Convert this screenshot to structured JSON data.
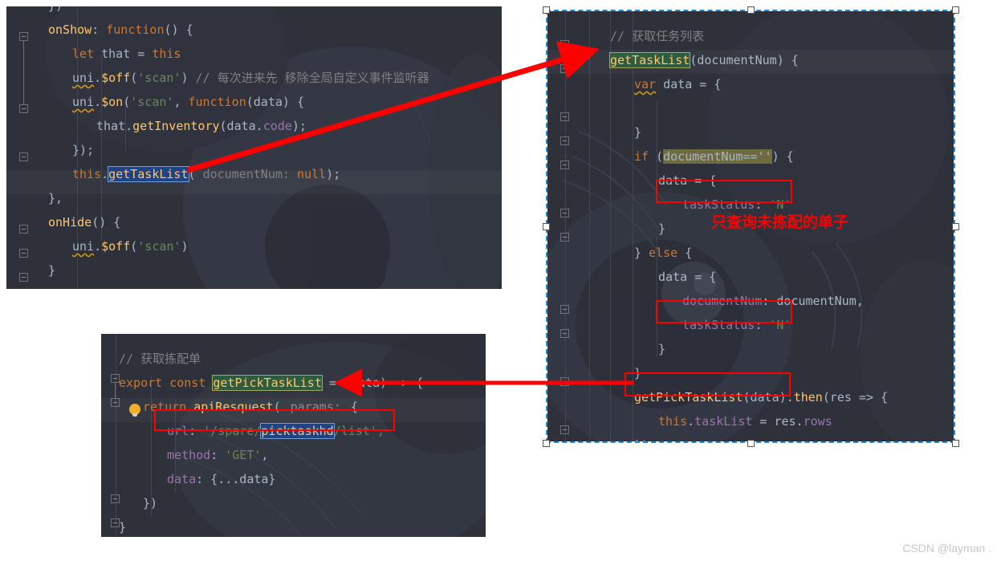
{
  "watermark": "CSDN @layman .",
  "annotation": {
    "note_cn": "只查询未拣配的单子"
  },
  "panel_left_top": {
    "name": "onShow / onHide page lifecycle code",
    "lines": [
      {
        "indent": 0,
        "tokens": [
          {
            "t": "})",
            "c": "punc"
          }
        ]
      },
      {
        "indent": 0,
        "tokens": [
          {
            "t": "onShow",
            "c": "fn"
          },
          {
            "t": ": ",
            "c": "punc"
          },
          {
            "t": "function",
            "c": "kw"
          },
          {
            "t": "() {",
            "c": "punc"
          }
        ]
      },
      {
        "indent": 1,
        "tokens": [
          {
            "t": "let",
            "c": "kw"
          },
          {
            "t": " that = ",
            "c": "txt"
          },
          {
            "t": "this",
            "c": "kw"
          }
        ]
      },
      {
        "indent": 1,
        "tokens": [
          {
            "t": "uni",
            "c": "squiggle"
          },
          {
            "t": ".",
            "c": "punc"
          },
          {
            "t": "$off",
            "c": "fn"
          },
          {
            "t": "(",
            "c": "punc"
          },
          {
            "t": "'scan'",
            "c": "str"
          },
          {
            "t": ") ",
            "c": "punc"
          },
          {
            "t": "// 每次进来先 移除全局自定义事件监听器",
            "c": "cmt"
          }
        ]
      },
      {
        "indent": 1,
        "tokens": [
          {
            "t": "uni",
            "c": "squiggle"
          },
          {
            "t": ".",
            "c": "punc"
          },
          {
            "t": "$on",
            "c": "fn"
          },
          {
            "t": "(",
            "c": "punc"
          },
          {
            "t": "'scan'",
            "c": "str"
          },
          {
            "t": ", ",
            "c": "punc"
          },
          {
            "t": "function",
            "c": "kw"
          },
          {
            "t": "(data) {",
            "c": "punc"
          }
        ]
      },
      {
        "indent": 2,
        "tokens": [
          {
            "t": "that.",
            "c": "txt"
          },
          {
            "t": "getInventory",
            "c": "fn"
          },
          {
            "t": "(data.",
            "c": "punc"
          },
          {
            "t": "code",
            "c": "prop"
          },
          {
            "t": ");",
            "c": "punc"
          }
        ]
      },
      {
        "indent": 1,
        "tokens": [
          {
            "t": "});",
            "c": "punc"
          }
        ]
      },
      {
        "indent": 1,
        "tokens": [
          {
            "t": "this",
            "c": "kw"
          },
          {
            "t": ".",
            "c": "punc"
          },
          {
            "t": "getTaskList",
            "c": "sel-blue"
          },
          {
            "t": "( ",
            "c": "punc"
          },
          {
            "t": "documentNum:",
            "c": "param"
          },
          {
            "t": " ",
            "c": "punc"
          },
          {
            "t": "null",
            "c": "kw"
          },
          {
            "t": ");",
            "c": "punc"
          }
        ]
      },
      {
        "indent": 0,
        "tokens": [
          {
            "t": "},",
            "c": "punc"
          }
        ]
      },
      {
        "indent": 0,
        "tokens": [
          {
            "t": "onHide",
            "c": "fn"
          },
          {
            "t": "() {",
            "c": "punc"
          }
        ]
      },
      {
        "indent": 1,
        "tokens": [
          {
            "t": "uni",
            "c": "squiggle"
          },
          {
            "t": ".",
            "c": "punc"
          },
          {
            "t": "$off",
            "c": "fn"
          },
          {
            "t": "(",
            "c": "punc"
          },
          {
            "t": "'scan'",
            "c": "str"
          },
          {
            "t": ")",
            "c": "punc"
          }
        ]
      },
      {
        "indent": 0,
        "tokens": [
          {
            "t": "}",
            "c": "punc"
          }
        ]
      }
    ]
  },
  "panel_bottom_left": {
    "name": "api definition getPickTaskList",
    "lines": [
      {
        "indent": 0,
        "tokens": [
          {
            "t": "// 获取拣配单",
            "c": "cmt"
          }
        ]
      },
      {
        "indent": 0,
        "tokens": [
          {
            "t": "export",
            "c": "kw"
          },
          {
            "t": " ",
            "c": "punc"
          },
          {
            "t": "const",
            "c": "kw"
          },
          {
            "t": " ",
            "c": "punc"
          },
          {
            "t": "getPickTaskList",
            "c": "hl-green"
          },
          {
            "t": " = (data) => {",
            "c": "txt"
          }
        ]
      },
      {
        "indent": 1,
        "tokens": [
          {
            "t": "return",
            "c": "kw"
          },
          {
            "t": " ",
            "c": "punc"
          },
          {
            "t": "apiResquest",
            "c": "fn"
          },
          {
            "t": "( ",
            "c": "punc"
          },
          {
            "t": "params:",
            "c": "inlay"
          },
          {
            "t": " {",
            "c": "punc"
          }
        ]
      },
      {
        "indent": 2,
        "tokens": [
          {
            "t": "url",
            "c": "prop"
          },
          {
            "t": ": ",
            "c": "punc"
          },
          {
            "t": "'/spare/",
            "c": "str"
          },
          {
            "t": "picktaskhd",
            "c": "sel-blue2"
          },
          {
            "t": "/list',",
            "c": "str"
          }
        ]
      },
      {
        "indent": 2,
        "tokens": [
          {
            "t": "method",
            "c": "prop"
          },
          {
            "t": ": ",
            "c": "punc"
          },
          {
            "t": "'GET'",
            "c": "str"
          },
          {
            "t": ",",
            "c": "punc"
          }
        ]
      },
      {
        "indent": 2,
        "tokens": [
          {
            "t": "data",
            "c": "prop"
          },
          {
            "t": ": {...data}",
            "c": "txt"
          }
        ]
      },
      {
        "indent": 1,
        "tokens": [
          {
            "t": "})",
            "c": "punc"
          }
        ]
      },
      {
        "indent": 0,
        "tokens": [
          {
            "t": "}",
            "c": "punc"
          }
        ]
      }
    ]
  },
  "panel_right": {
    "name": "getTaskList method implementation",
    "lines": [
      {
        "indent": 1,
        "tokens": [
          {
            "t": "// 获取任务列表",
            "c": "cmt"
          }
        ]
      },
      {
        "indent": 1,
        "tokens": [
          {
            "t": "getTaskList",
            "c": "hl-green"
          },
          {
            "t": "(documentNum) {",
            "c": "punc"
          }
        ]
      },
      {
        "indent": 2,
        "tokens": [
          {
            "t": "var",
            "c": "kw squiggle"
          },
          {
            "t": " data = {",
            "c": "txt"
          }
        ]
      },
      {
        "indent": 2,
        "tokens": [
          {
            "t": "",
            "c": "punc"
          }
        ]
      },
      {
        "indent": 2,
        "tokens": [
          {
            "t": "}",
            "c": "punc"
          }
        ]
      },
      {
        "indent": 2,
        "tokens": [
          {
            "t": "if",
            "c": "kw"
          },
          {
            "t": " (",
            "c": "punc"
          },
          {
            "t": "documentNum==''",
            "c": "hl-olive"
          },
          {
            "t": ") {",
            "c": "punc"
          }
        ]
      },
      {
        "indent": 3,
        "tokens": [
          {
            "t": "data = {",
            "c": "txt"
          }
        ]
      },
      {
        "indent": 4,
        "tokens": [
          {
            "t": "taskStatus",
            "c": "prop"
          },
          {
            "t": ": ",
            "c": "punc"
          },
          {
            "t": "'N'",
            "c": "str"
          }
        ]
      },
      {
        "indent": 3,
        "tokens": [
          {
            "t": "}",
            "c": "punc"
          }
        ]
      },
      {
        "indent": 2,
        "tokens": [
          {
            "t": "} ",
            "c": "punc"
          },
          {
            "t": "else",
            "c": "kw"
          },
          {
            "t": " {",
            "c": "punc"
          }
        ]
      },
      {
        "indent": 3,
        "tokens": [
          {
            "t": "data = {",
            "c": "txt"
          }
        ]
      },
      {
        "indent": 4,
        "tokens": [
          {
            "t": "documentNum",
            "c": "prop"
          },
          {
            "t": ": documentNum,",
            "c": "txt"
          }
        ]
      },
      {
        "indent": 4,
        "tokens": [
          {
            "t": "taskStatus",
            "c": "prop"
          },
          {
            "t": ": ",
            "c": "punc"
          },
          {
            "t": "'N'",
            "c": "str"
          }
        ]
      },
      {
        "indent": 3,
        "tokens": [
          {
            "t": "}",
            "c": "punc"
          }
        ]
      },
      {
        "indent": 2,
        "tokens": [
          {
            "t": "}",
            "c": "punc"
          }
        ]
      },
      {
        "indent": 2,
        "tokens": [
          {
            "t": "getPickTaskList",
            "c": "fn"
          },
          {
            "t": "(data)",
            "c": "punc"
          },
          {
            "t": ".",
            "c": "punc"
          },
          {
            "t": "then",
            "c": "fn"
          },
          {
            "t": "(res => {",
            "c": "punc"
          }
        ]
      },
      {
        "indent": 3,
        "tokens": [
          {
            "t": "this",
            "c": "kw"
          },
          {
            "t": ".",
            "c": "punc"
          },
          {
            "t": "taskList",
            "c": "prop"
          },
          {
            "t": " = res.",
            "c": "txt"
          },
          {
            "t": "rows",
            "c": "prop"
          }
        ]
      },
      {
        "indent": 2,
        "tokens": [
          {
            "t": "})",
            "c": "punc"
          }
        ]
      }
    ]
  },
  "colors": {
    "editor_bg": "#2e313a",
    "accent_red": "#ff0000",
    "selection_blue": "#214283",
    "usage_green": "#2f5c3f",
    "search_olive": "#6d6b3f",
    "marquee_blue": "#1f8bd6"
  }
}
